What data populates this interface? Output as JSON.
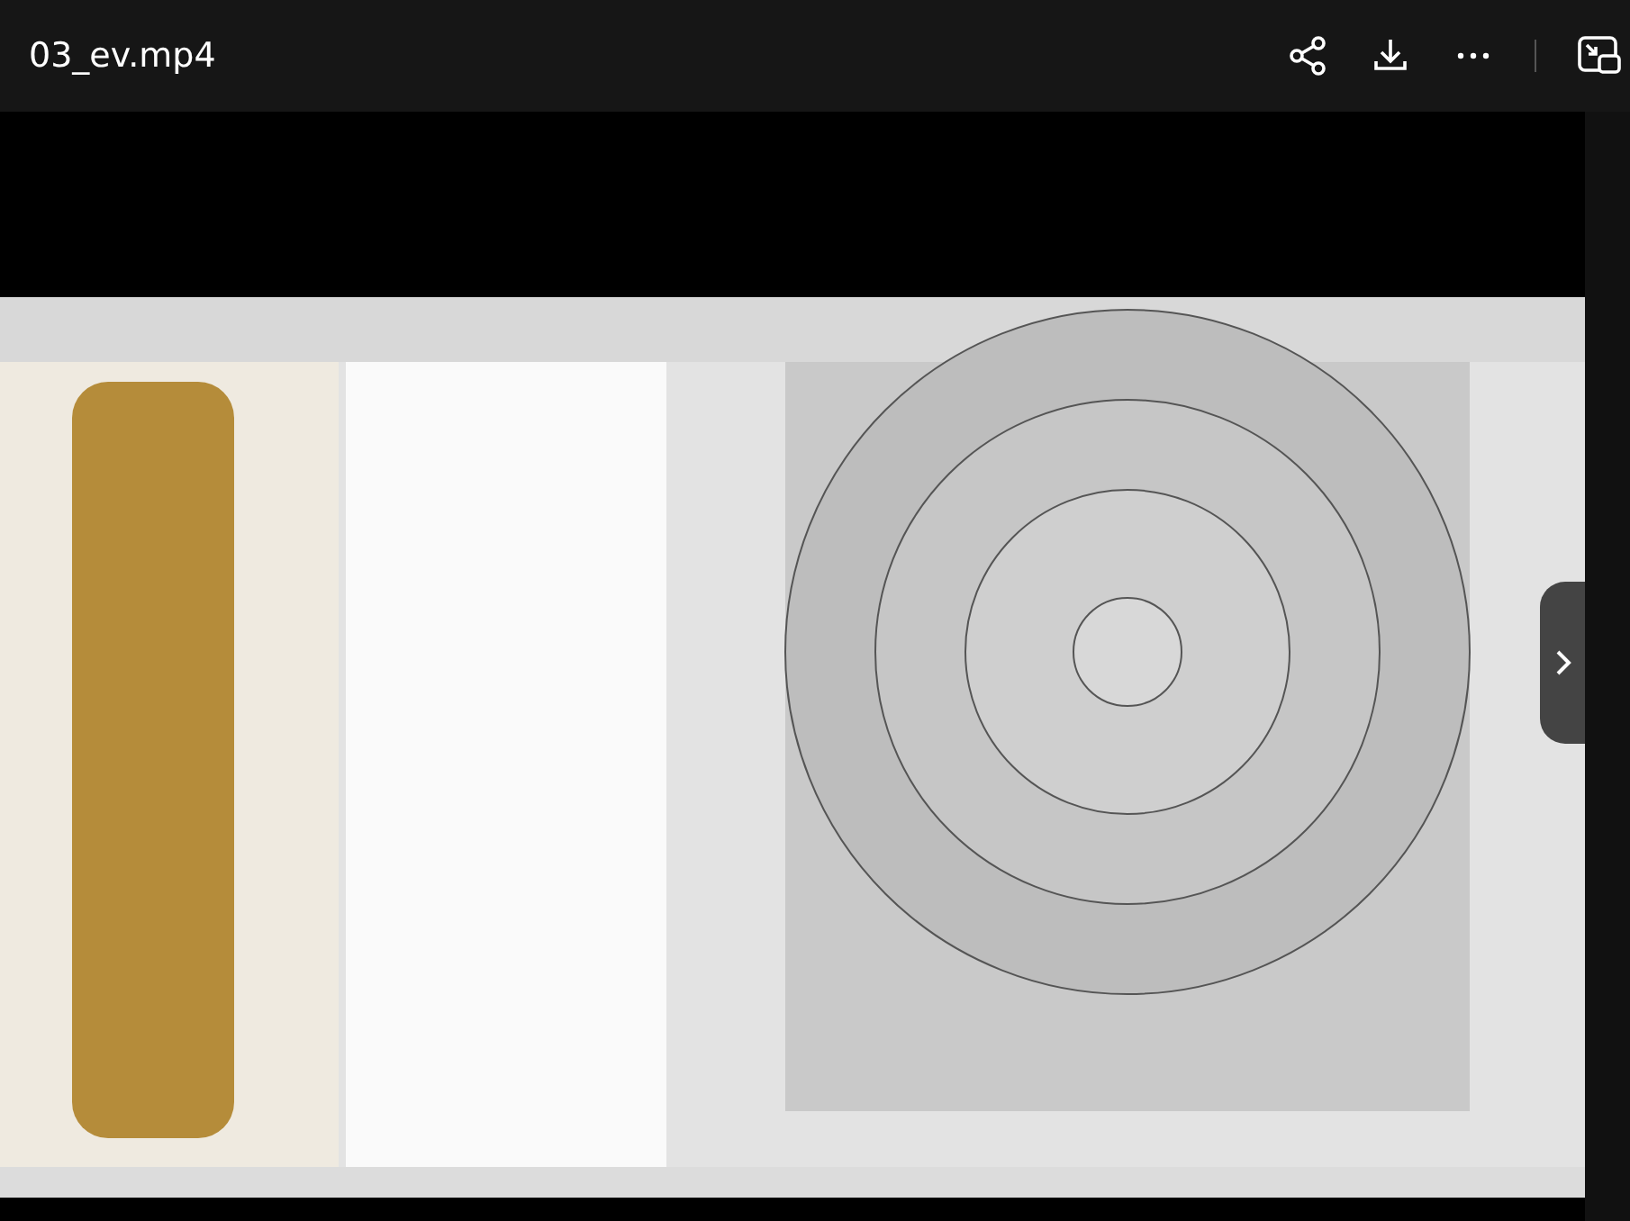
{
  "window": {
    "title": "03_ev.mp4"
  }
}
